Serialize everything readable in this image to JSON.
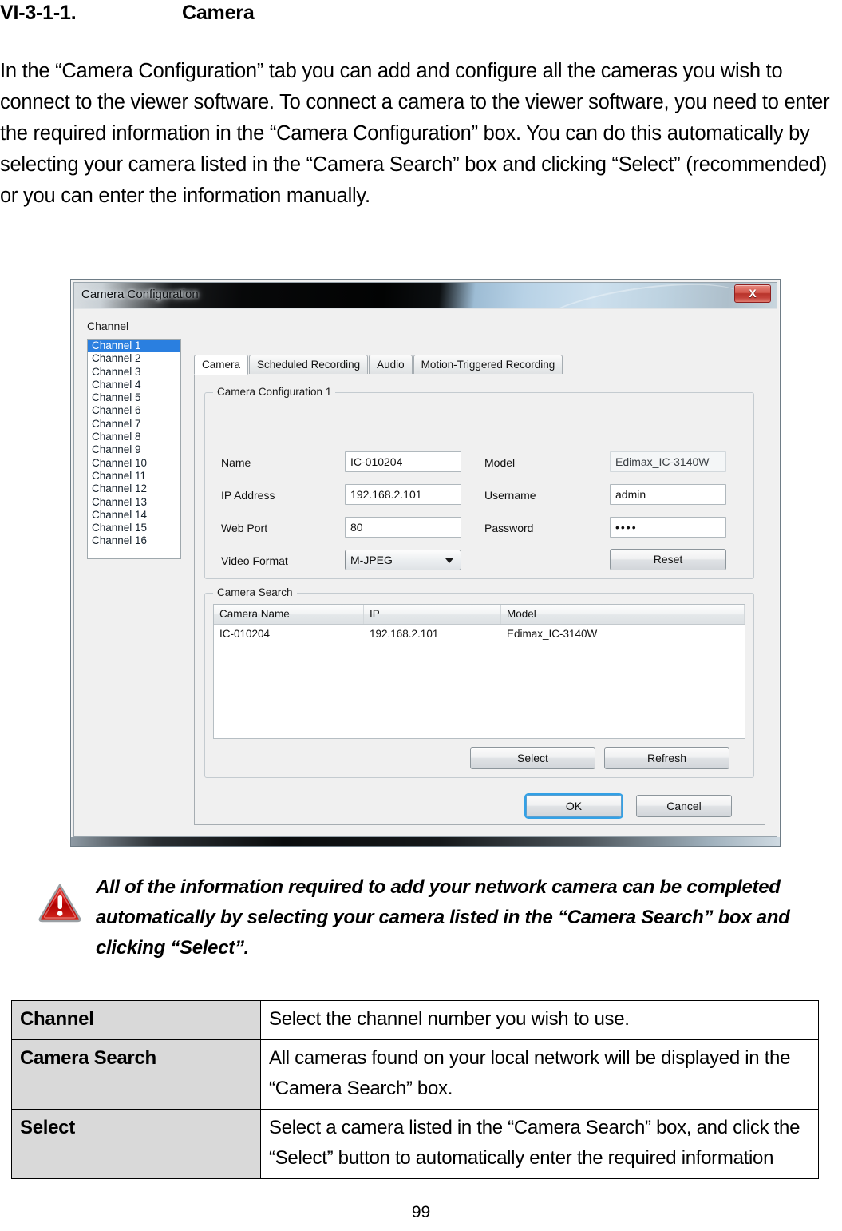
{
  "document": {
    "heading_number": "VI-3-1-1.",
    "heading_title": "Camera",
    "paragraph": "In the “Camera Configuration” tab you can add and configure all the cameras you wish to connect to the viewer software. To connect a camera to the viewer software, you need to enter the required information in the “Camera Configuration” box. You can do this automatically by selecting your camera listed in the “Camera Search” box and clicking “Select” (recommended) or you can enter the information manually.",
    "page_number": "99"
  },
  "dialog": {
    "title": "Camera Configuration",
    "close_label": "X",
    "channel": {
      "label": "Channel",
      "items": [
        "Channel 1",
        "Channel 2",
        "Channel 3",
        "Channel 4",
        "Channel 5",
        "Channel 6",
        "Channel 7",
        "Channel 8",
        "Channel 9",
        "Channel 10",
        "Channel 11",
        "Channel 12",
        "Channel 13",
        "Channel 14",
        "Channel 15",
        "Channel 16"
      ],
      "selected_index": 0
    },
    "tabs": [
      {
        "label": "Camera",
        "active": true
      },
      {
        "label": "Scheduled Recording",
        "active": false
      },
      {
        "label": "Audio",
        "active": false
      },
      {
        "label": "Motion-Triggered Recording",
        "active": false
      }
    ],
    "camera_config": {
      "legend": "Camera Configuration 1",
      "fields": {
        "name_label": "Name",
        "name_value": "IC-010204",
        "ip_label": "IP Address",
        "ip_value": "192.168.2.101",
        "webport_label": "Web Port",
        "webport_value": "80",
        "videoformat_label": "Video Format",
        "videoformat_value": "M-JPEG",
        "model_label": "Model",
        "model_value": "Edimax_IC-3140W",
        "username_label": "Username",
        "username_value": "admin",
        "password_label": "Password",
        "password_value": "••••"
      },
      "reset_label": "Reset"
    },
    "camera_search": {
      "legend": "Camera Search",
      "columns": [
        "Camera Name",
        "IP",
        "Model",
        ""
      ],
      "rows": [
        [
          "IC-010204",
          "192.168.2.101",
          "Edimax_IC-3140W",
          ""
        ]
      ],
      "select_label": "Select",
      "refresh_label": "Refresh"
    },
    "ok_label": "OK",
    "cancel_label": "Cancel",
    "accent_color": "#2a7fe0",
    "close_color": "#b8342b",
    "focus_color": "#33a1e6"
  },
  "note": {
    "icon": "warning-triangle-icon",
    "icon_color": "#cc0000",
    "text": "All of the information required to add your network camera can be completed automatically by selecting your camera listed in the “Camera Search” box and clicking “Select”."
  },
  "reference_table": {
    "rows": [
      {
        "key": "Channel",
        "value": "Select the channel number you wish to use."
      },
      {
        "key": "Camera Search",
        "value": "All cameras found on your local network will be displayed in the “Camera Search” box."
      },
      {
        "key": "Select",
        "value": "Select a camera listed in the “Camera Search” box, and click the “Select” button to automatically enter the required information"
      }
    ]
  }
}
